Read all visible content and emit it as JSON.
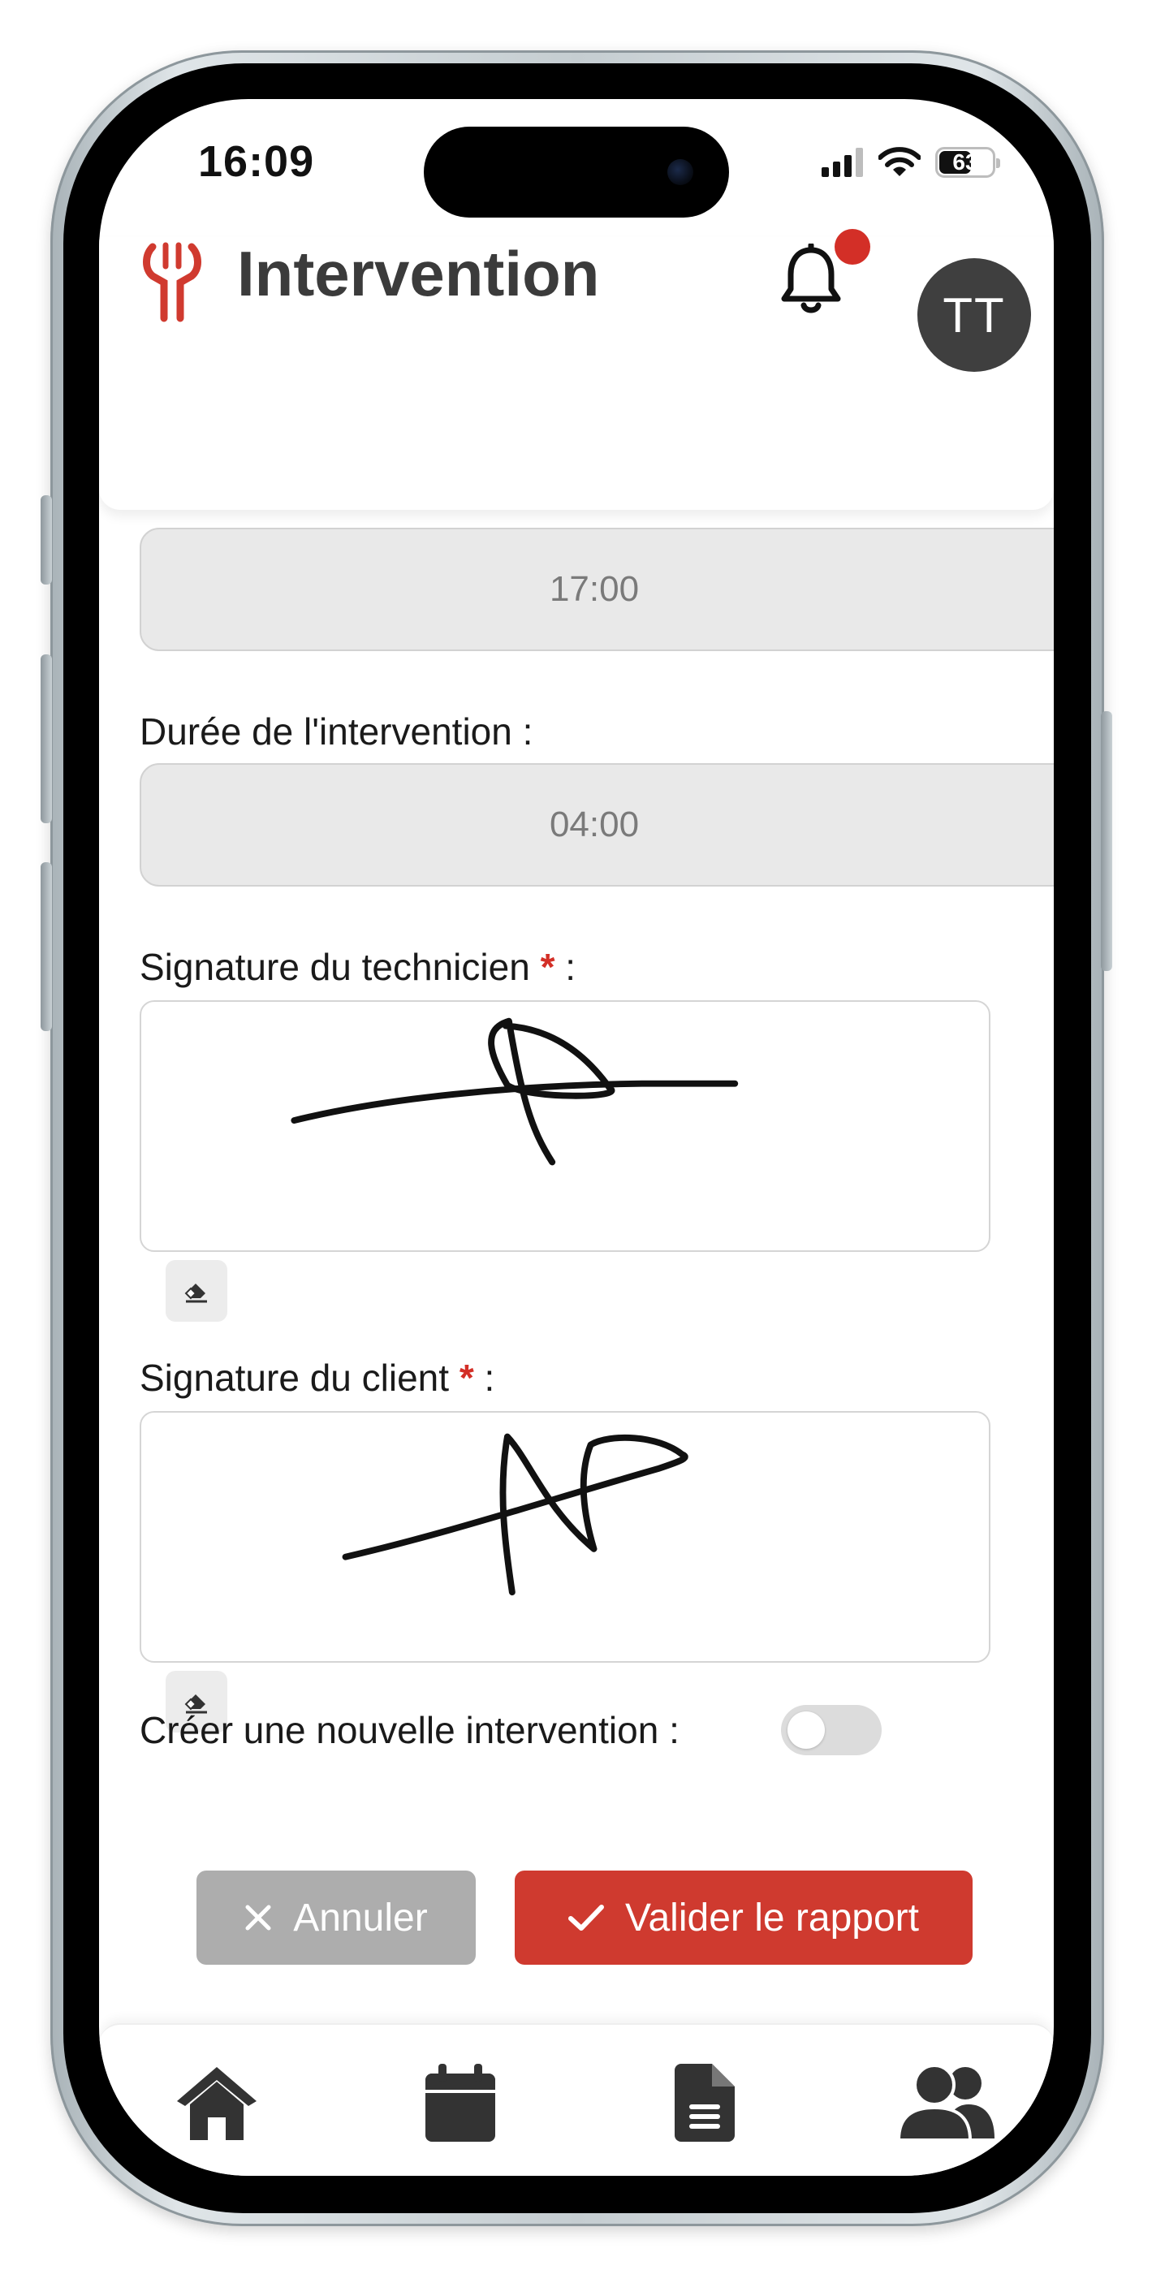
{
  "status_bar": {
    "time": "16:09",
    "battery_level": "63",
    "battery_fraction": 0.63,
    "icons": [
      "signal-icon",
      "wifi-icon",
      "battery-icon"
    ]
  },
  "header": {
    "title": "Intervention",
    "avatar_initials": "TT",
    "logo_icon": "tools-logo-icon",
    "notification_icon": "bell-icon",
    "has_unread_notification": true
  },
  "form": {
    "end_time_value": "17:00",
    "duration_label": "Durée de l'intervention :",
    "duration_value": "04:00",
    "tech_signature_label": "Signature du technicien",
    "client_signature_label": "Signature du client",
    "required_marker": "*",
    "label_suffix": ":",
    "new_intervention_label": "Créer une nouvelle intervention :",
    "new_intervention_enabled": false,
    "clear_icon": "eraser-icon"
  },
  "actions": {
    "cancel_label": "Annuler",
    "validate_label": "Valider le rapport",
    "cancel_icon": "close-icon",
    "validate_icon": "check-icon"
  },
  "bottom_nav": {
    "items": [
      {
        "name": "home",
        "icon": "home-icon"
      },
      {
        "name": "calendar",
        "icon": "calendar-icon"
      },
      {
        "name": "documents",
        "icon": "document-icon"
      },
      {
        "name": "users",
        "icon": "users-icon"
      }
    ]
  },
  "colors": {
    "accent": "#cf3a2f",
    "notification_dot": "#d32f27",
    "avatar_bg": "#3f3f3f",
    "cancel_bg": "#adadad",
    "field_bg": "#e9e9e9"
  }
}
